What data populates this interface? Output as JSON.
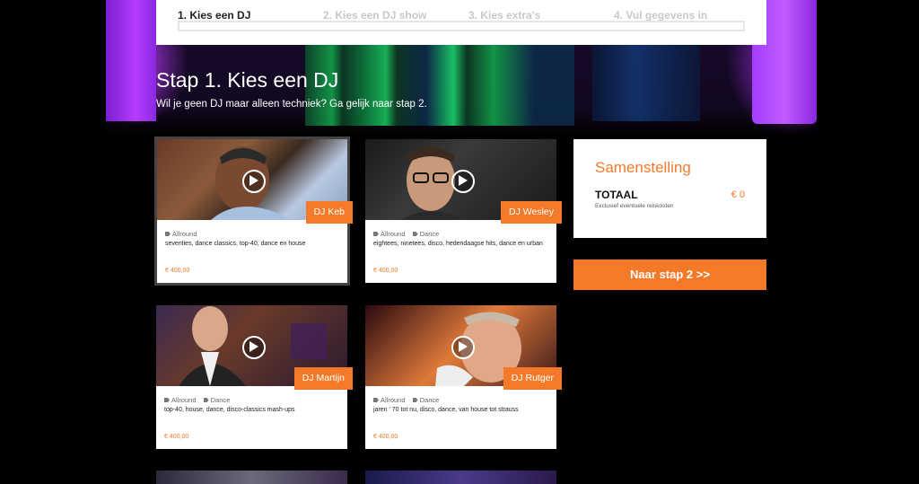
{
  "steps": [
    {
      "label": "1. Kies een DJ",
      "active": true
    },
    {
      "label": "2. Kies een DJ show",
      "active": false
    },
    {
      "label": "3. Kies extra's",
      "active": false
    },
    {
      "label": "4. Vul gegevens in",
      "active": false
    }
  ],
  "page": {
    "title": "Stap 1. Kies een DJ",
    "subtitle": "Wil je geen DJ maar alleen techniek? Ga gelijk naar stap 2."
  },
  "djs": [
    {
      "name": "DJ Keb",
      "tags": [
        "Allround"
      ],
      "genres": "seventies, dance classics, top-40, dance en house",
      "price": "€ 400,00",
      "selected": true
    },
    {
      "name": "DJ Wesley",
      "tags": [
        "Allround",
        "Dance"
      ],
      "genres": "eightees, ninetees, disco, hedendaagse hits, dance en urban",
      "price": "€ 400,00",
      "selected": false
    },
    {
      "name": "DJ Martijn",
      "tags": [
        "Allround",
        "Dance"
      ],
      "genres": "top-40, house, dance, disco-classics mash-ups",
      "price": "€ 400,00",
      "selected": false
    },
    {
      "name": "DJ Rutger",
      "tags": [
        "Allround",
        "Dance"
      ],
      "genres": "jaren ' 70 tot nu, disco, dance, van house tot strauss",
      "price": "€ 400,00",
      "selected": false
    }
  ],
  "summary": {
    "title": "Samenstelling",
    "total_label": "TOTAAL",
    "total_amount": "€ 0",
    "note": "Exclusief eventuele reiskosten"
  },
  "next_button": "Naar stap 2 >>",
  "colors": {
    "accent": "#f47a2a"
  }
}
